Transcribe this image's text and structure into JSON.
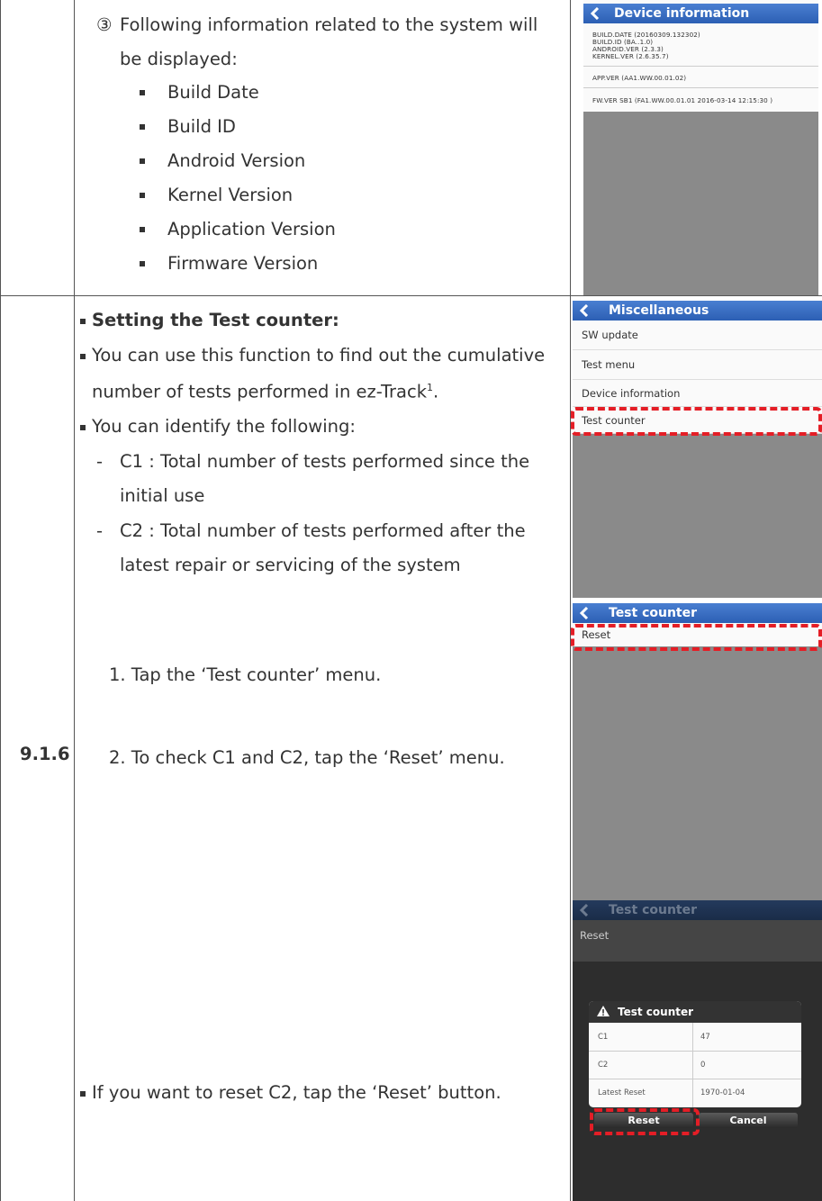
{
  "row1": {
    "intro_marker": "③",
    "intro_line1": "Following information related to the system will",
    "intro_line2": "be displayed:",
    "items": [
      "Build Date",
      "Build ID",
      "Android Version",
      "Kernel Version",
      "Application Version",
      "Firmware Version"
    ]
  },
  "row2": {
    "section_number": "9.1.6",
    "heading": "Setting the Test counter:",
    "para1_line1": "You can use this function to find out the cumulative",
    "para1_line2a": "number of tests performed in ez-Track",
    "para1_sup": "1",
    "para1_line2b": ".",
    "para2": "You can identify the following:",
    "c1_line1": "C1 : Total number of tests performed since the",
    "c1_line2": "initial use",
    "c2_line1": "C2 : Total number of tests performed after the",
    "c2_line2": "latest repair or servicing of the system",
    "dash": "-",
    "step1": "1.  Tap the ‘Test counter’ menu.",
    "step2": "2.  To check C1 and C2, tap the ‘Reset’ menu.",
    "reset_note": "If you want to reset C2, tap the ‘Reset’ button."
  },
  "screens": {
    "device_info": {
      "title": "Device information",
      "block1": [
        "BUILD.DATE (20160309.132302)",
        "BUILD.ID (BA..1.0)",
        "ANDROID.VER (2.3.3)",
        "KERNEL.VER (2.6.35.7)"
      ],
      "app_ver": "APP.VER (AA1.WW.00.01.02)",
      "fw_ver": "FW.VER SB1 (FA1.WW.00.01.01   2016-03-14   12:15:30   )"
    },
    "misc": {
      "title": "Miscellaneous",
      "items": [
        "SW update",
        "Test menu",
        "Device information",
        "Test counter"
      ]
    },
    "test_counter": {
      "title": "Test counter",
      "items": [
        "Reset"
      ]
    },
    "dialog_screen": {
      "title": "Test counter",
      "menu_item": "Reset",
      "dialog_title": "Test counter",
      "rows": [
        {
          "label": "C1",
          "value": "47"
        },
        {
          "label": "C2",
          "value": "0"
        },
        {
          "label": "Latest Reset",
          "value": "1970-01-04"
        }
      ],
      "reset_button": "Reset",
      "cancel_button": "Cancel"
    }
  },
  "colors": {
    "header_blue": "#3a6fc4",
    "highlight_red": "#e41e26",
    "screen_gray": "#8a8a8a"
  }
}
